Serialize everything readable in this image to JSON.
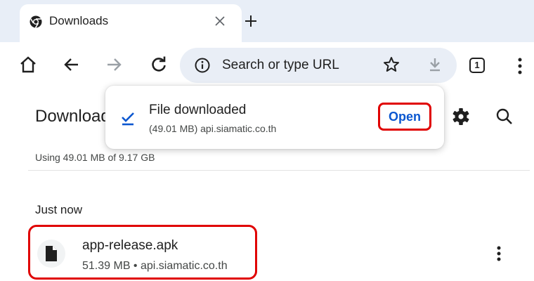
{
  "tab": {
    "title": "Downloads",
    "close_icon": "close-icon",
    "new_tab_icon": "plus-icon"
  },
  "toolbar": {
    "icons": [
      "home-icon",
      "back-arrow-icon",
      "forward-arrow-icon",
      "reload-icon",
      "info-icon",
      "star-icon",
      "download-icon",
      "tab-switcher-icon",
      "more-vert-icon"
    ],
    "omnibox_placeholder": "Search or type URL",
    "tab_count": "1"
  },
  "page": {
    "title": "Downloads",
    "storage_text": "Using 49.01 MB of 9.17 GB",
    "section_label": "Just now",
    "items": [
      {
        "name": "app-release.apk",
        "meta": "51.39 MB • api.siamatic.co.th",
        "icon": "file-icon"
      }
    ]
  },
  "popup": {
    "title": "File downloaded",
    "subtitle": "(49.01 MB) api.siamatic.co.th",
    "action_label": "Open",
    "icon": "check-icon"
  },
  "colors": {
    "tab_strip": "#e8eef7",
    "omnibox": "#e9eef6",
    "accent": "#0b57d0",
    "highlight": "#e00000"
  }
}
